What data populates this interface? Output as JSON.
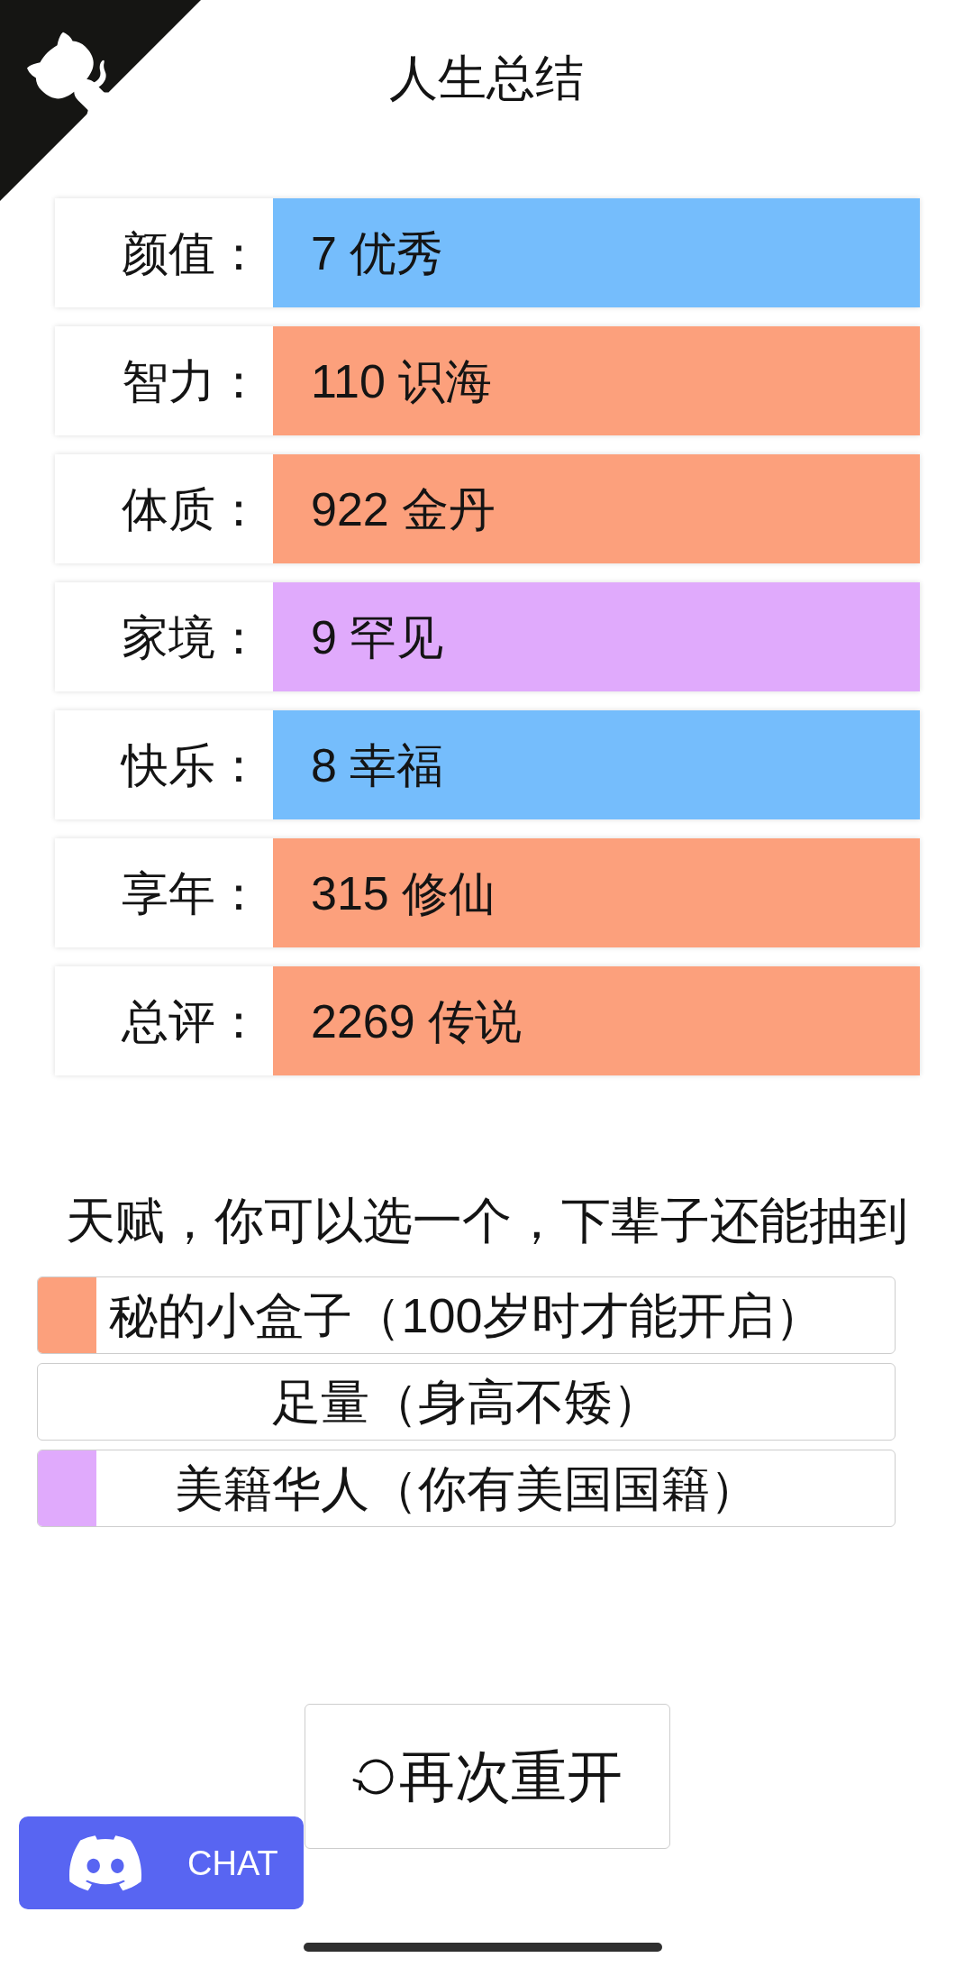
{
  "title": "人生总结",
  "stats": [
    {
      "label": "颜值：",
      "value": "7 优秀",
      "color": "#75bdfc"
    },
    {
      "label": "智力：",
      "value": "110 识海",
      "color": "#fca07c"
    },
    {
      "label": "体质：",
      "value": "922 金丹",
      "color": "#fca07c"
    },
    {
      "label": "家境：",
      "value": "9 罕见",
      "color": "#e0aafc"
    },
    {
      "label": "快乐：",
      "value": "8 幸福",
      "color": "#75bdfc"
    },
    {
      "label": "享年：",
      "value": "315 修仙",
      "color": "#fca07c"
    },
    {
      "label": "总评：",
      "value": "2269 传说",
      "color": "#fca07c"
    }
  ],
  "talents": {
    "heading": "天赋，你可以选一个，下辈子还能抽到",
    "items": [
      {
        "text": "秘的小盒子（100岁时才能开启）",
        "color": "#fca07c",
        "selected": false
      },
      {
        "text": "足量（身高不矮）",
        "selected": false
      },
      {
        "text": "美籍华人（你有美国国籍）",
        "color": "#e0aafc",
        "selected": false
      }
    ]
  },
  "restart_button": {
    "label": "再次重开"
  },
  "chat_button": {
    "label": "CHAT"
  }
}
